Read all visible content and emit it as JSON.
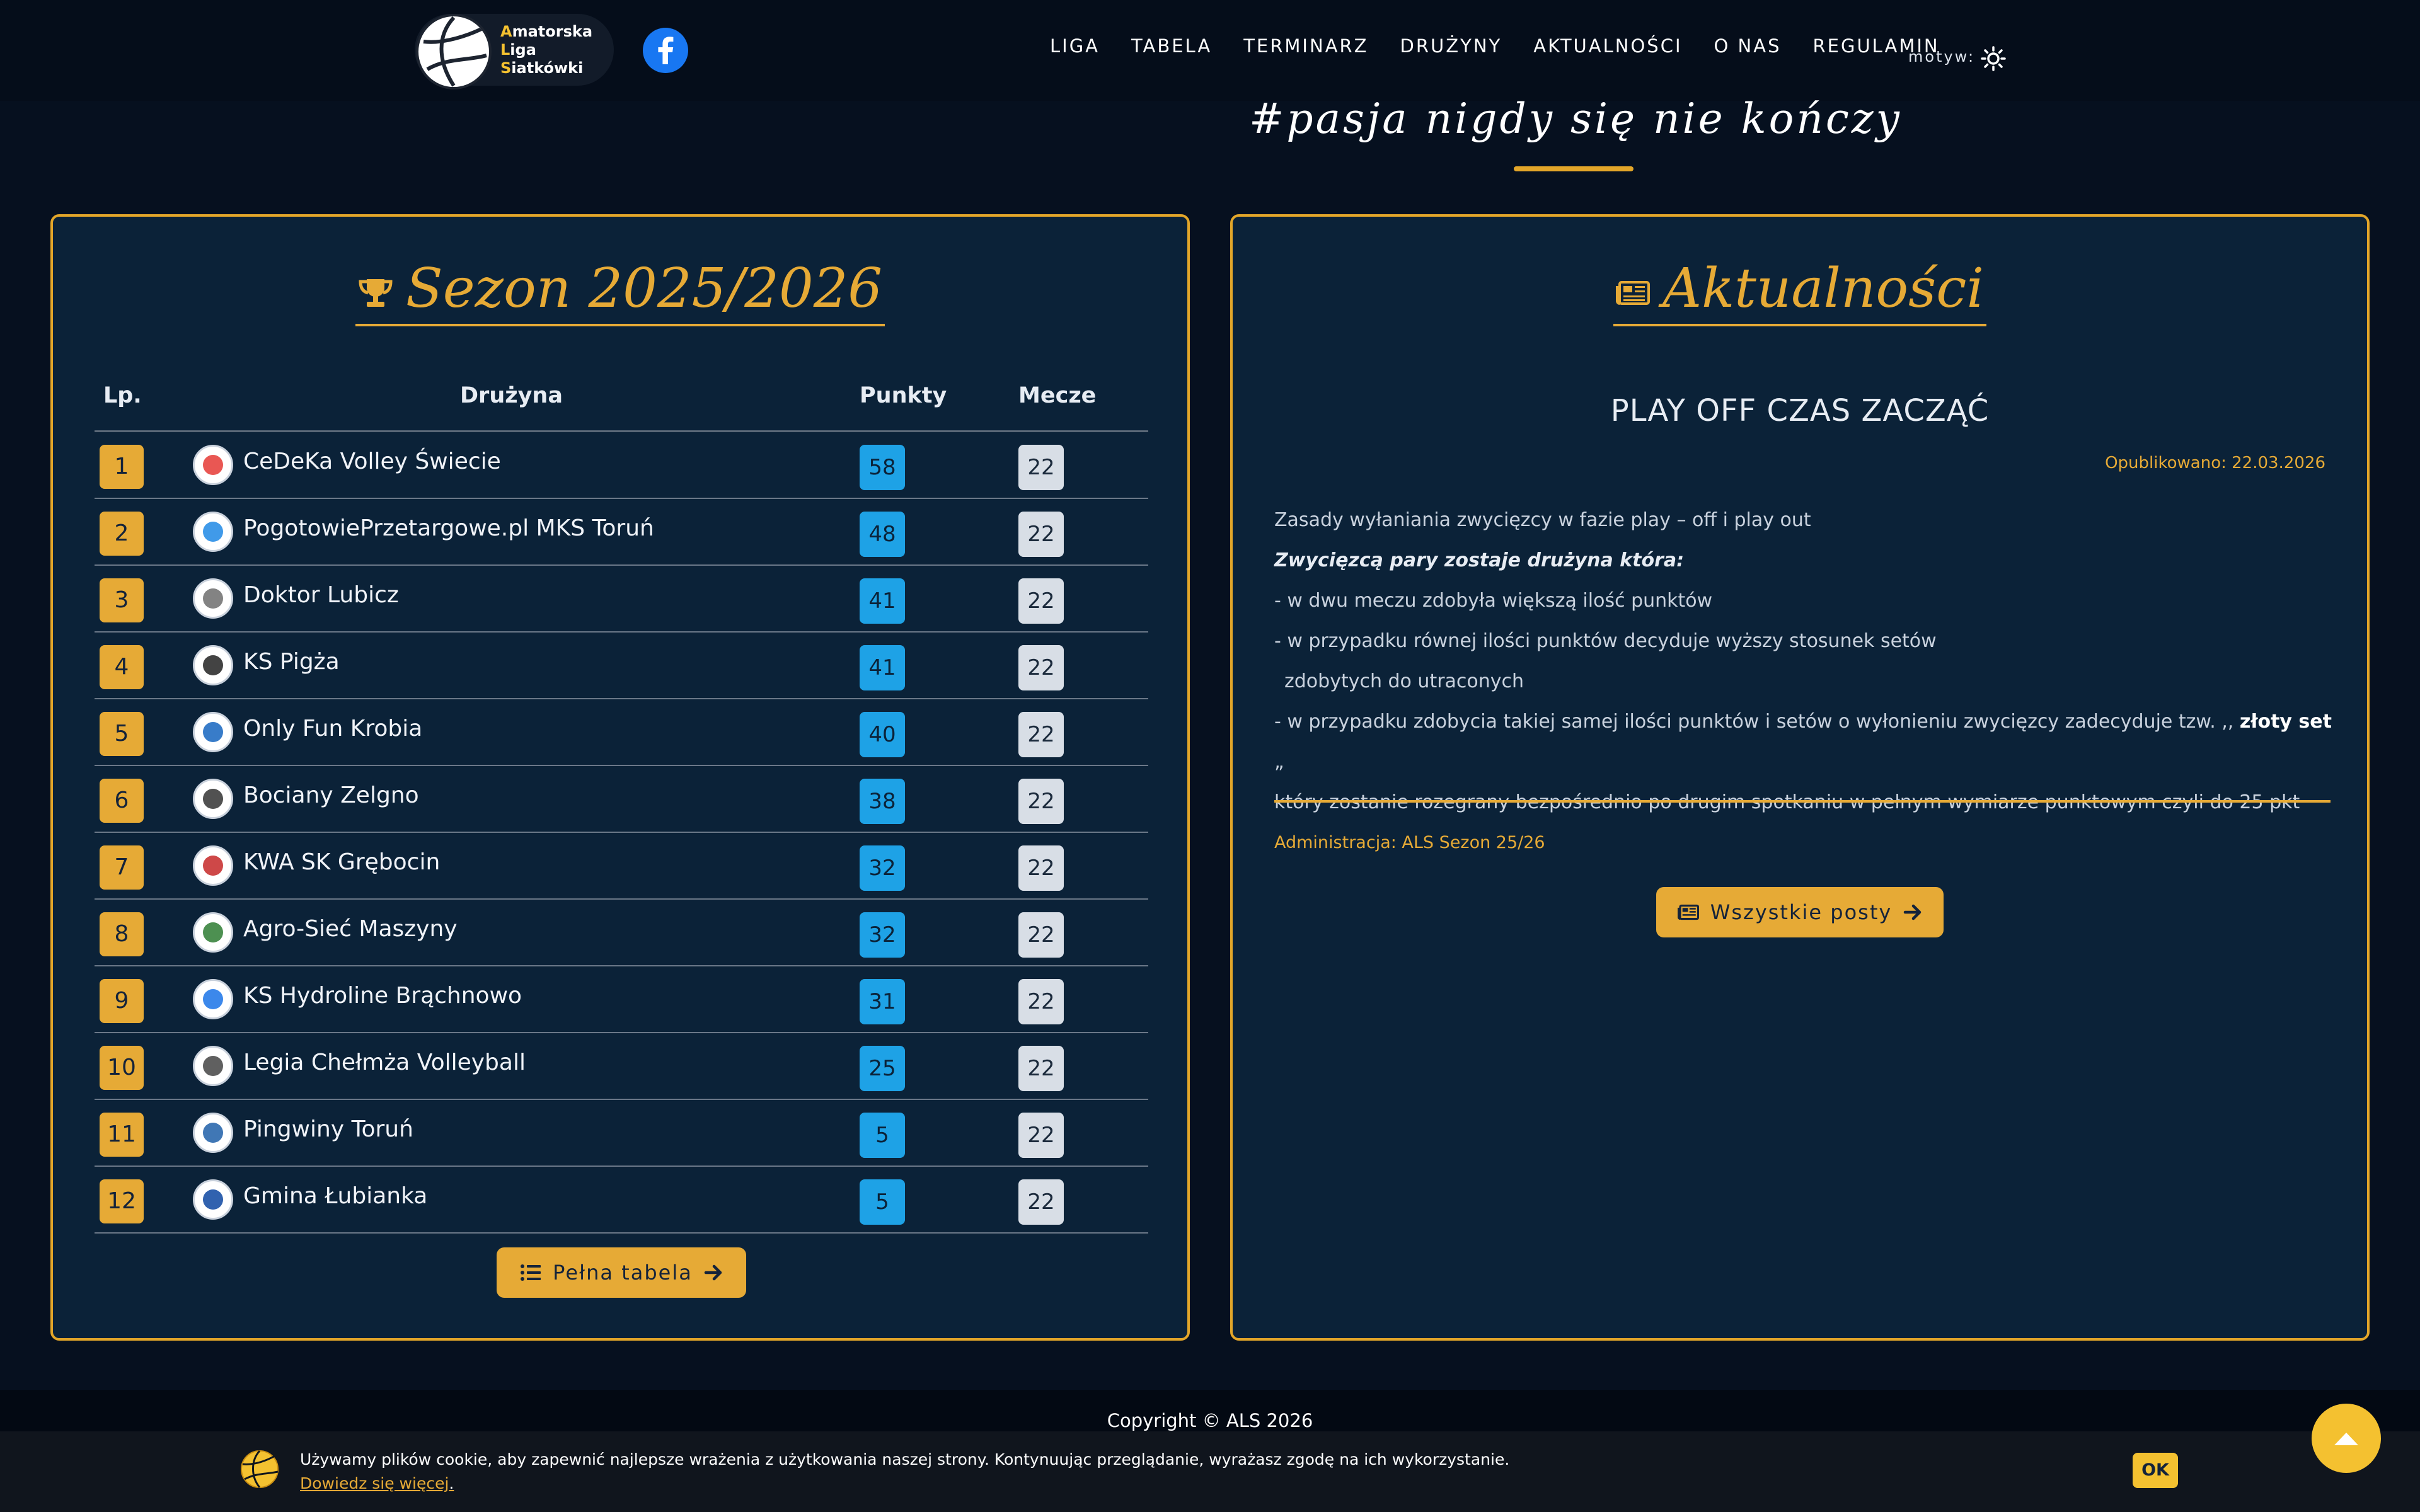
{
  "nav": {
    "logo_lines": [
      {
        "first": "A",
        "rest": "matorska"
      },
      {
        "first": "L",
        "rest": "iga"
      },
      {
        "first": "S",
        "rest": "iatkówki"
      }
    ],
    "menu": [
      "LIGA",
      "TABELA",
      "TERMINARZ",
      "DRUŻYNY",
      "AKTUALNOŚCI",
      "O NAS",
      "REGULAMIN"
    ],
    "theme_label": "motyw:"
  },
  "tagline": "#pasja nigdy się nie kończy",
  "standings": {
    "title": "Sezon 2025/2026",
    "headers": {
      "rank": "Lp.",
      "team": "Drużyna",
      "points": "Punkty",
      "games": "Mecze"
    },
    "rows": [
      {
        "rank": "1",
        "team": "CeDeKa Volley Świecie",
        "points": "58",
        "games": "22"
      },
      {
        "rank": "2",
        "team": "PogotowiePrzetargowe.pl MKS Toruń",
        "points": "48",
        "games": "22"
      },
      {
        "rank": "3",
        "team": "Doktor Lubicz",
        "points": "41",
        "games": "22"
      },
      {
        "rank": "4",
        "team": "KS Pigża",
        "points": "41",
        "games": "22"
      },
      {
        "rank": "5",
        "team": "Only Fun Krobia",
        "points": "40",
        "games": "22"
      },
      {
        "rank": "6",
        "team": "Bociany Zelgno",
        "points": "38",
        "games": "22"
      },
      {
        "rank": "7",
        "team": "KWA SK Grębocin",
        "points": "32",
        "games": "22"
      },
      {
        "rank": "8",
        "team": "Agro-Sieć Maszyny",
        "points": "32",
        "games": "22"
      },
      {
        "rank": "9",
        "team": "KS Hydroline Brąchnowo",
        "points": "31",
        "games": "22"
      },
      {
        "rank": "10",
        "team": "Legia Chełmża Volleyball",
        "points": "25",
        "games": "22"
      },
      {
        "rank": "11",
        "team": "Pingwiny Toruń",
        "points": "5",
        "games": "22"
      },
      {
        "rank": "12",
        "team": "Gmina Łubianka",
        "points": "5",
        "games": "22"
      }
    ],
    "button_label": "Pełna tabela"
  },
  "news": {
    "title": "Aktualności",
    "post_title": "PLAY OFF CZAS ZACZĄĆ",
    "published": "Opublikowano: 22.03.2026",
    "line1": "Zasady wyłaniania zwycięzcy w   fazie play – off i play out",
    "line2": "Zwycięzcą pary zostaje drużyna która:",
    "line3": "- w dwu meczu zdobyła większą ilość punktów",
    "line4": "- w przypadku równej ilości punktów decyduje wyższy stosunek setów",
    "line5": "zdobytych do utraconych",
    "line6a": "- w przypadku zdobycia takiej samej ilości punktów i setów o wyłonieniu zwycięzcy zadecyduje tzw. ,, ",
    "line6b": "złoty set",
    "line6c": " „",
    "line7": "który zostanie rozegrany bezpośrednio po drugim spotkaniu w pełnym wymiarze punktowym czyli do 25 pkt",
    "admin": "Administracja: ALS Sezon 25/26",
    "button_label": "Wszystkie posty"
  },
  "footer": {
    "copyright": "Copyright © ALS 2026"
  },
  "cookie": {
    "text": "Używamy plików cookie, aby zapewnić najlepsze wrażenia z użytkowania naszej strony. Kontynuując przeglądanie, wyrażasz zgodę na ich wykorzystanie.",
    "link": "Dowiedz się więcej",
    "link_suffix": ".",
    "ok": "OK"
  },
  "colors": {
    "accent": "#e6aa36",
    "points": "#1ea2e6",
    "background": "#06101f",
    "card": "#0b2238"
  }
}
